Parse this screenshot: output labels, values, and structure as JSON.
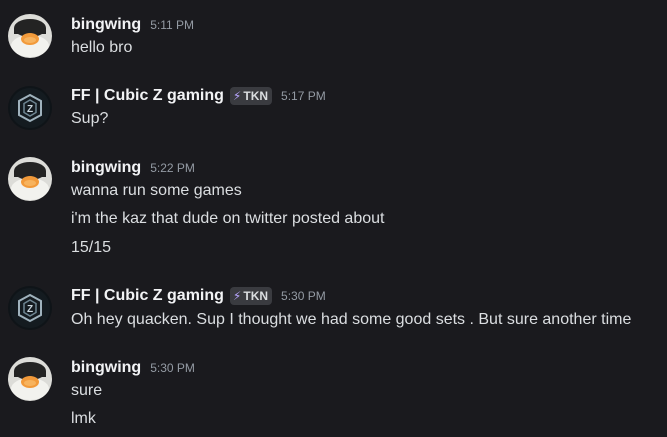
{
  "messages": [
    {
      "author": "bingwing",
      "avatar_icon": "penguin-avatar-icon",
      "badge": null,
      "time": "5:11 PM",
      "lines": [
        "hello bro"
      ]
    },
    {
      "author": "FF | Cubic Z gaming",
      "avatar_icon": "cubic-z-logo-avatar-icon",
      "badge": "TKN",
      "badge_icon": "lightning-bolt-icon",
      "time": "5:17 PM",
      "lines": [
        "Sup?"
      ]
    },
    {
      "author": "bingwing",
      "avatar_icon": "penguin-avatar-icon",
      "badge": null,
      "time": "5:22 PM",
      "lines": [
        "wanna run some games",
        "i'm the kaz that dude on twitter posted about",
        "15/15"
      ]
    },
    {
      "author": "FF | Cubic Z gaming",
      "avatar_icon": "cubic-z-logo-avatar-icon",
      "badge": "TKN",
      "badge_icon": "lightning-bolt-icon",
      "time": "5:30 PM",
      "lines": [
        "Oh hey quacken.  Sup I thought we had some good  sets . But sure another time"
      ]
    },
    {
      "author": "bingwing",
      "avatar_icon": "penguin-avatar-icon",
      "badge": null,
      "time": "5:30 PM",
      "lines": [
        "sure",
        "lmk"
      ]
    }
  ],
  "colors": {
    "background": "#1a1a1e",
    "username": "#f2f3f5",
    "text": "#dbdee1",
    "timestamp": "#949ba4",
    "badge_bg": "#3a3b40",
    "badge_bolt": "#b8a5ff"
  }
}
